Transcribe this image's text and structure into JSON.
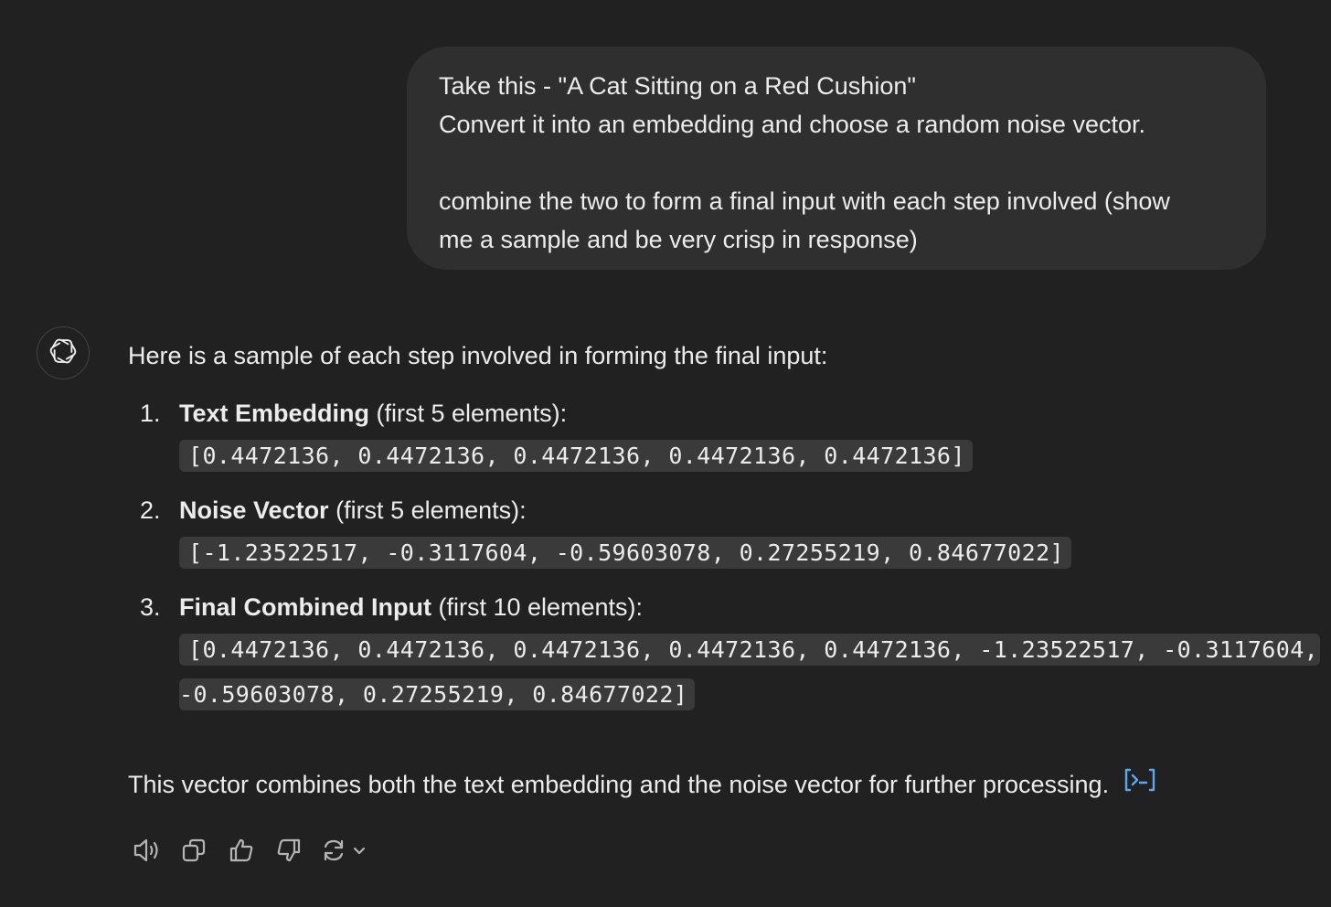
{
  "user_message": {
    "lines": [
      "Take this - \"A Cat Sitting on a Red Cushion\"",
      "Convert it into an embedding and choose a random noise vector.",
      "",
      "combine the two to form a final input with each step involved (show",
      "me a sample and be very crisp in response)"
    ]
  },
  "assistant": {
    "avatar_icon": "openai-logo-icon",
    "intro": "Here is a sample of each step involved in forming the final input:",
    "steps": [
      {
        "number": "1.",
        "title": "Text Embedding",
        "suffix": " (first 5 elements):",
        "code_lines": [
          "[0.4472136, 0.4472136, 0.4472136, 0.4472136, 0.4472136]"
        ]
      },
      {
        "number": "2.",
        "title": "Noise Vector",
        "suffix": " (first 5 elements):",
        "code_lines": [
          "[-1.23522517, -0.3117604, -0.59603078, 0.27255219, 0.84677022]"
        ]
      },
      {
        "number": "3.",
        "title": "Final Combined Input",
        "suffix": " (first 10 elements):",
        "code_lines": [
          "[0.4472136, 0.4472136, 0.4472136, 0.4472136, 0.4472136, -1.23522517, -0.3117604,",
          "-0.59603078, 0.27255219, 0.84677022]"
        ]
      }
    ],
    "outro": "This vector combines both the text embedding and the noise vector for further processing.",
    "citation_icon": "code-interpreter-icon"
  },
  "actions": [
    {
      "name": "read-aloud-icon"
    },
    {
      "name": "copy-icon"
    },
    {
      "name": "thumbs-up-icon"
    },
    {
      "name": "thumbs-down-icon"
    },
    {
      "name": "regenerate-icon"
    }
  ],
  "colors": {
    "background": "#212121",
    "user_bubble": "#2f2f2f",
    "code_background": "#3a3a3a",
    "text": "#ececec",
    "accent_link": "#5aa9f0"
  }
}
